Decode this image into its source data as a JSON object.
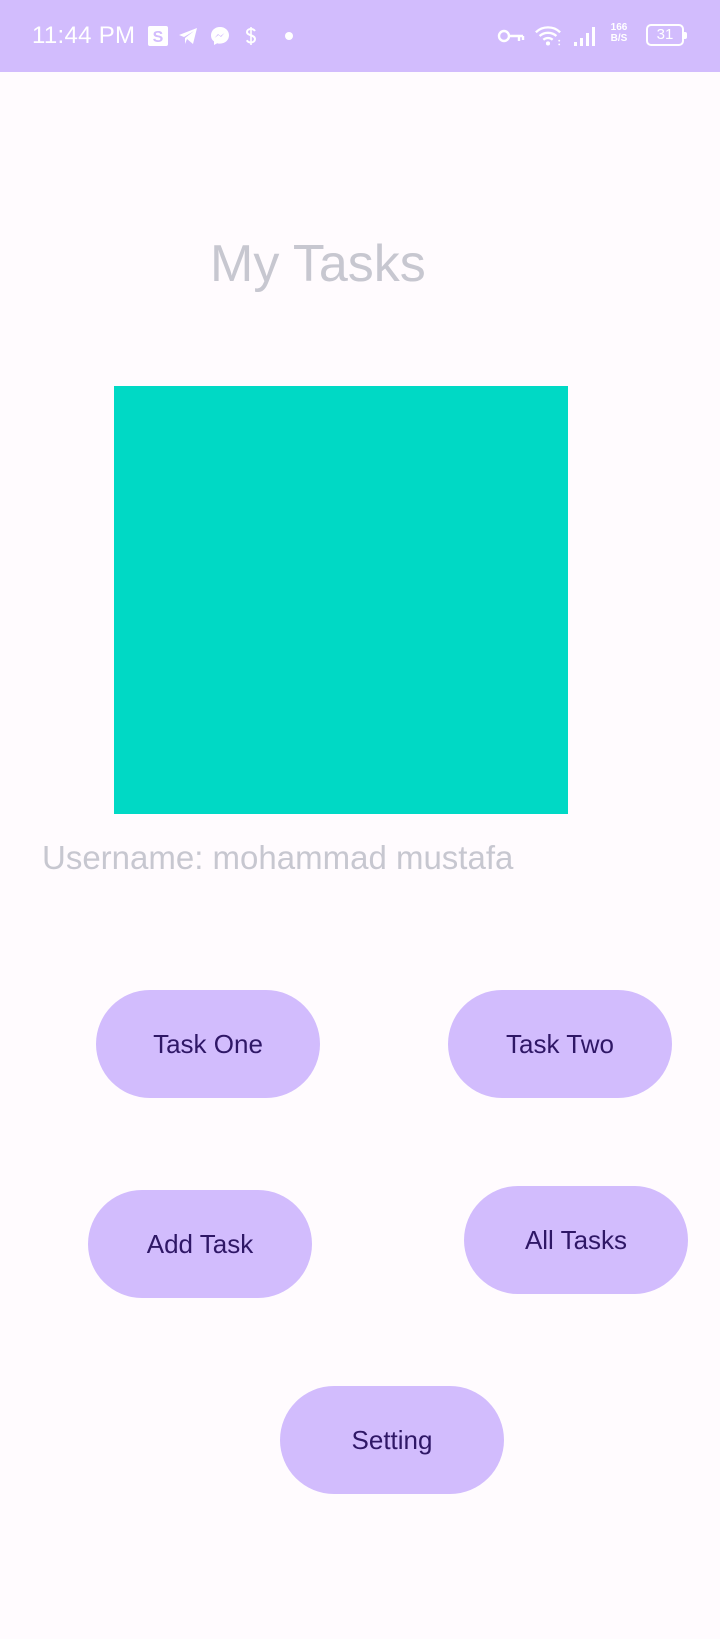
{
  "status_bar": {
    "time": "11:44 PM",
    "notification_icons": [
      "s-app-icon",
      "telegram-icon",
      "messenger-icon",
      "s-dollar-icon",
      "dot-icon"
    ],
    "system_icons": [
      "vpn-key-icon",
      "wifi-icon",
      "signal-icon"
    ],
    "network_speed_value": "166",
    "network_speed_unit": "B/S",
    "battery": "31",
    "color": "#d2bcfd"
  },
  "page": {
    "title": "My Tasks",
    "image_color": "#00d9c5",
    "username_label": "Username: mohammad mustafa"
  },
  "buttons": {
    "task_one": "Task One",
    "task_two": "Task Two",
    "add_task": "Add Task",
    "all_tasks": "All Tasks",
    "setting": "Setting",
    "color": "#d2bcfd",
    "text_color": "#2f1766"
  }
}
